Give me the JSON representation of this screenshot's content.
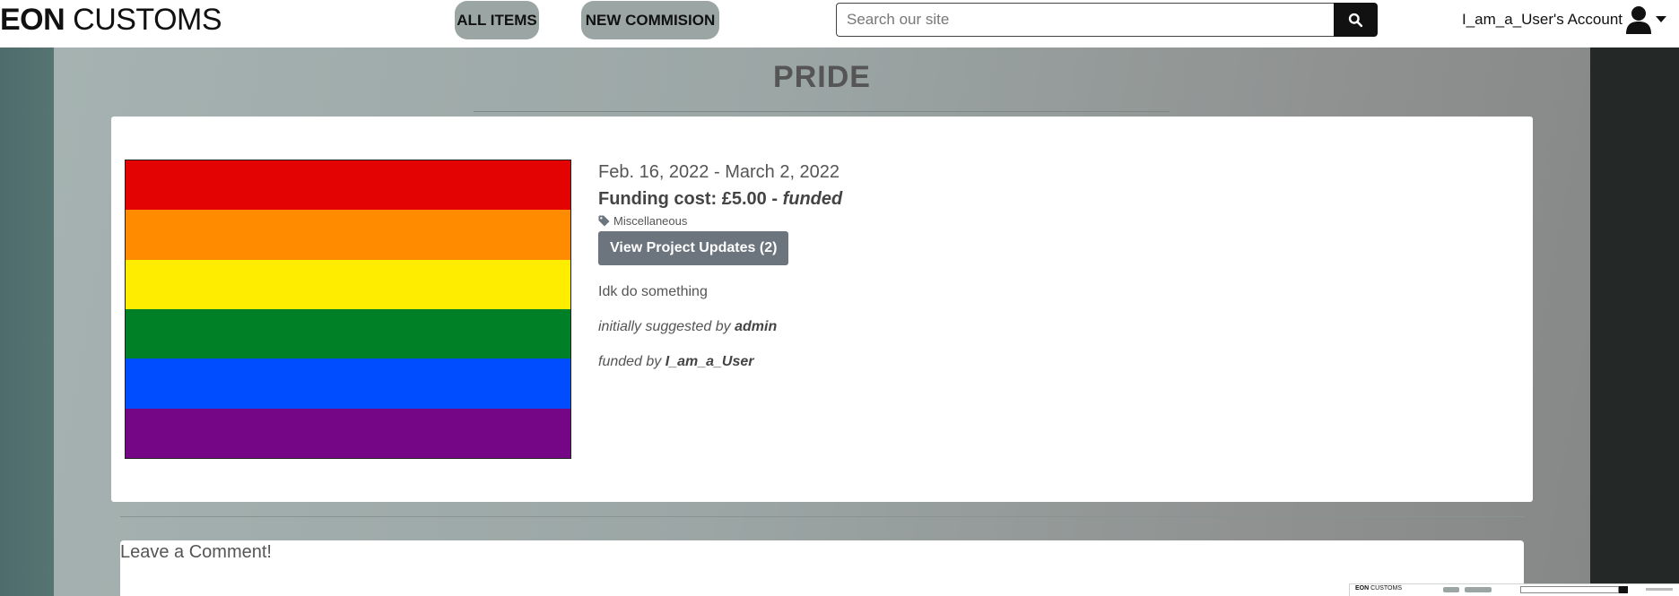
{
  "header": {
    "logo_bold": "EON",
    "logo_rest": " CUSTOMS",
    "nav": {
      "all_items": "ALL ITEMS",
      "new_commission": "NEW COMMISION"
    },
    "search": {
      "placeholder": "Search our site",
      "value": ""
    },
    "account_label": "I_am_a_User's Account",
    "icons": [
      "search-icon",
      "user-icon",
      "caret-down-icon"
    ]
  },
  "page": {
    "title": "PRIDE"
  },
  "project": {
    "dates": "Feb. 16, 2022 - March 2, 2022",
    "funding_label": "Funding cost: £5.00 - ",
    "funding_status": "funded",
    "category": "Miscellaneous",
    "category_icon": "tag-icon",
    "updates_button": "View Project Updates (2)",
    "description": "Idk do something",
    "suggested_prefix": "initially suggested by ",
    "suggested_by": "admin",
    "funded_prefix": "funded by ",
    "funded_by": "I_am_a_User",
    "image": {
      "type": "rainbow-flag",
      "stripes": [
        "#e40303",
        "#ff8c00",
        "#ffed00",
        "#008026",
        "#004dff",
        "#750787"
      ]
    }
  },
  "comments": {
    "title": "Leave a Comment!"
  },
  "colors": {
    "nav_button": "#9aa5a4",
    "updates_button": "#6c757d",
    "search_button": "#111111",
    "right_sidebar": "#242827",
    "left_sidebar": "#4e6c6c"
  }
}
